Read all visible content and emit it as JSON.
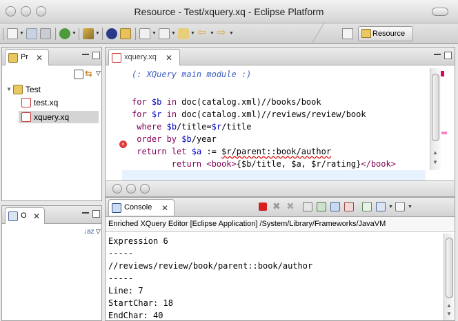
{
  "window": {
    "title": "Resource - Test/xquery.xq - Eclipse Platform"
  },
  "toolbar": {
    "perspective_label": "Resource"
  },
  "project_explorer": {
    "tab_label": "Pr",
    "tree": {
      "root": "Test",
      "children": [
        "test.xq",
        "xquery.xq"
      ]
    }
  },
  "outline": {
    "tab_label": "O"
  },
  "editor": {
    "tab_label": "xquery.xq",
    "lines": {
      "l1": "(: XQuery main module :)",
      "l3_kw1": "for",
      "l3_var": "$b",
      "l3_kw2": "in",
      "l3_rest": "doc(catalog.xml)//books/book",
      "l4_kw1": "for",
      "l4_var": "$r",
      "l4_kw2": "in",
      "l4_rest": "doc(catalog.xml)//reviews/review/book",
      "l5_kw": "where",
      "l5_var1": "$b",
      "l5_mid": "/title=",
      "l5_var2": "$r",
      "l5_end": "/title",
      "l6_kw": "order by",
      "l6_var": "$b",
      "l6_end": "/year",
      "l7_kw1": "return",
      "l7_kw2": "let",
      "l7_var": "$a",
      "l7_op": ":=",
      "l7_err": "$r/parent::book/author",
      "l8_kw": "return",
      "l8_tag1": "<book>",
      "l8_mid": "{$b/title, $a, $r/rating}",
      "l8_tag2": "</book>"
    }
  },
  "console": {
    "tab_label": "Console",
    "header": "Enriched XQuery Editor [Eclipse Application] /System/Library/Frameworks/JavaVM",
    "lines": [
      "Expression 6",
      "-----",
      "//reviews/review/book/parent::book/author",
      "-----",
      "Line: 7",
      "StartChar: 18",
      "EndChar: 40"
    ]
  },
  "colors": {
    "keyword": "#7f0055",
    "variable": "#0000c0",
    "comment": "#3f5fbf",
    "error": "#e00000"
  }
}
